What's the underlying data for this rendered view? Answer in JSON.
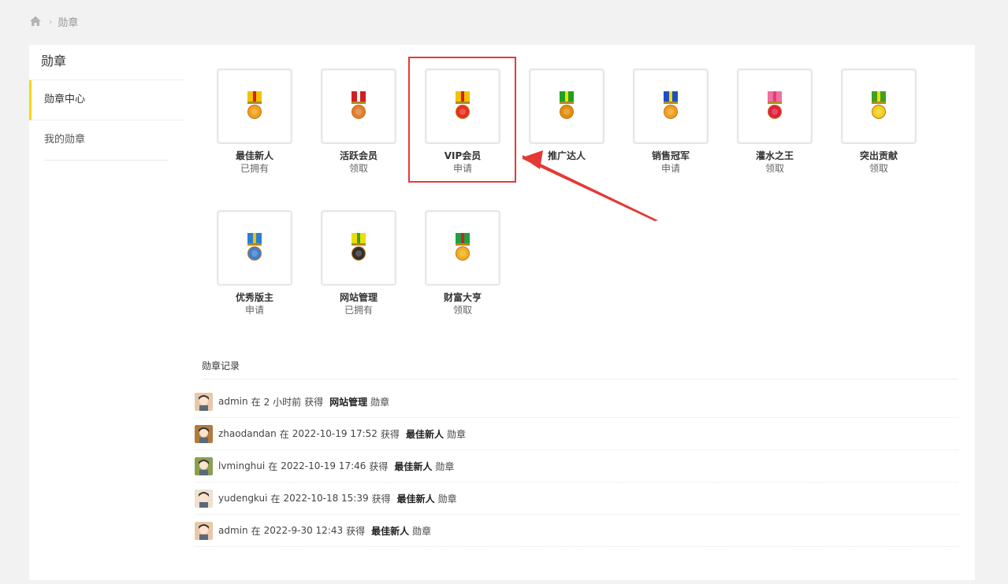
{
  "breadcrumb": {
    "home_icon": "home-icon",
    "current": "勋章"
  },
  "sidebar": {
    "title": "勋章",
    "items": [
      {
        "label": "勋章中心",
        "active": true
      },
      {
        "label": "我的勋章",
        "active": false
      }
    ]
  },
  "medals": [
    {
      "name": "最佳新人",
      "status": "已拥有",
      "ribbon": "#f2c200",
      "stripe": "#d02020",
      "disc": "#f0a020"
    },
    {
      "name": "活跃会员",
      "status": "领取",
      "ribbon": "#d02020",
      "stripe": "#ffffff",
      "disc": "#e08030"
    },
    {
      "name": "VIP会员",
      "status": "申请",
      "ribbon": "#f2c200",
      "stripe": "#d02020",
      "disc": "#e83020"
    },
    {
      "name": "推广达人",
      "status": "",
      "ribbon": "#20a020",
      "stripe": "#f2e000",
      "disc": "#e09010"
    },
    {
      "name": "销售冠军",
      "status": "申请",
      "ribbon": "#2050c0",
      "stripe": "#f2e000",
      "disc": "#f0a020"
    },
    {
      "name": "灌水之王",
      "status": "领取",
      "ribbon": "#f070a0",
      "stripe": "#e04070",
      "disc": "#e02040"
    },
    {
      "name": "突出贡献",
      "status": "领取",
      "ribbon": "#40a020",
      "stripe": "#f2e000",
      "disc": "#f0d020"
    },
    {
      "name": "优秀版主",
      "status": "申请",
      "ribbon": "#2a7fd0",
      "stripe": "#f2c200",
      "disc": "#4080d0"
    },
    {
      "name": "网站管理",
      "status": "已拥有",
      "ribbon": "#e8e000",
      "stripe": "#40a020",
      "disc": "#303030"
    },
    {
      "name": "财富大亨",
      "status": "领取",
      "ribbon": "#20a040",
      "stripe": "#d02020",
      "disc": "#f0b020"
    }
  ],
  "highlighted_medal": "VIP会员",
  "log": {
    "title": "勋章记录",
    "entries": [
      {
        "user": "admin",
        "word_at": "在",
        "time": "2 小时前",
        "word_got": "获得",
        "medal": "网站管理",
        "suffix": "勋章",
        "avatar_color": "#e9c8a8"
      },
      {
        "user": "zhaodandan",
        "word_at": "在",
        "time": "2022-10-19 17:52",
        "word_got": "获得",
        "medal": "最佳新人",
        "suffix": "勋章",
        "avatar_color": "#b07a40"
      },
      {
        "user": "lvminghui",
        "word_at": "在",
        "time": "2022-10-19 17:46",
        "word_got": "获得",
        "medal": "最佳新人",
        "suffix": "勋章",
        "avatar_color": "#8aa050"
      },
      {
        "user": "yudengkui",
        "word_at": "在",
        "time": "2022-10-18 15:39",
        "word_got": "获得",
        "medal": "最佳新人",
        "suffix": "勋章",
        "avatar_color": "#f0e0d0"
      },
      {
        "user": "admin",
        "word_at": "在",
        "time": "2022-9-30 12:43",
        "word_got": "获得",
        "medal": "最佳新人",
        "suffix": "勋章",
        "avatar_color": "#e9c8a8"
      }
    ]
  },
  "colors": {
    "accent": "#f5d800",
    "highlight": "#e53935"
  }
}
